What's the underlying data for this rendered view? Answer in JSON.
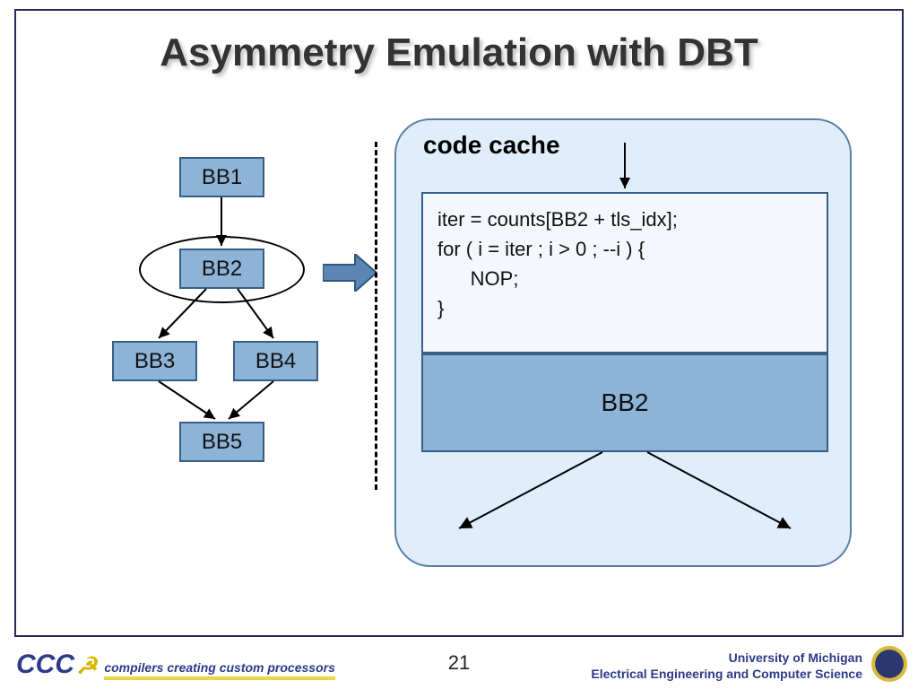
{
  "title": "Asymmetry Emulation with DBT",
  "flow": {
    "bb1": "BB1",
    "bb2": "BB2",
    "bb3": "BB3",
    "bb4": "BB4",
    "bb5": "BB5"
  },
  "cache": {
    "label": "code cache",
    "code_line1": "iter = counts[BB2 + tls_idx];",
    "code_line2": "for ( i = iter ; i > 0 ; --i ) {",
    "code_line3": "      NOP;",
    "code_line4": "}",
    "bb2_label": "BB2"
  },
  "footer": {
    "cccp": "CCC",
    "cccp_tagline": "compilers creating custom processors",
    "page": "21",
    "uni_line1": "University of Michigan",
    "uni_line2": "Electrical Engineering and Computer Science"
  }
}
